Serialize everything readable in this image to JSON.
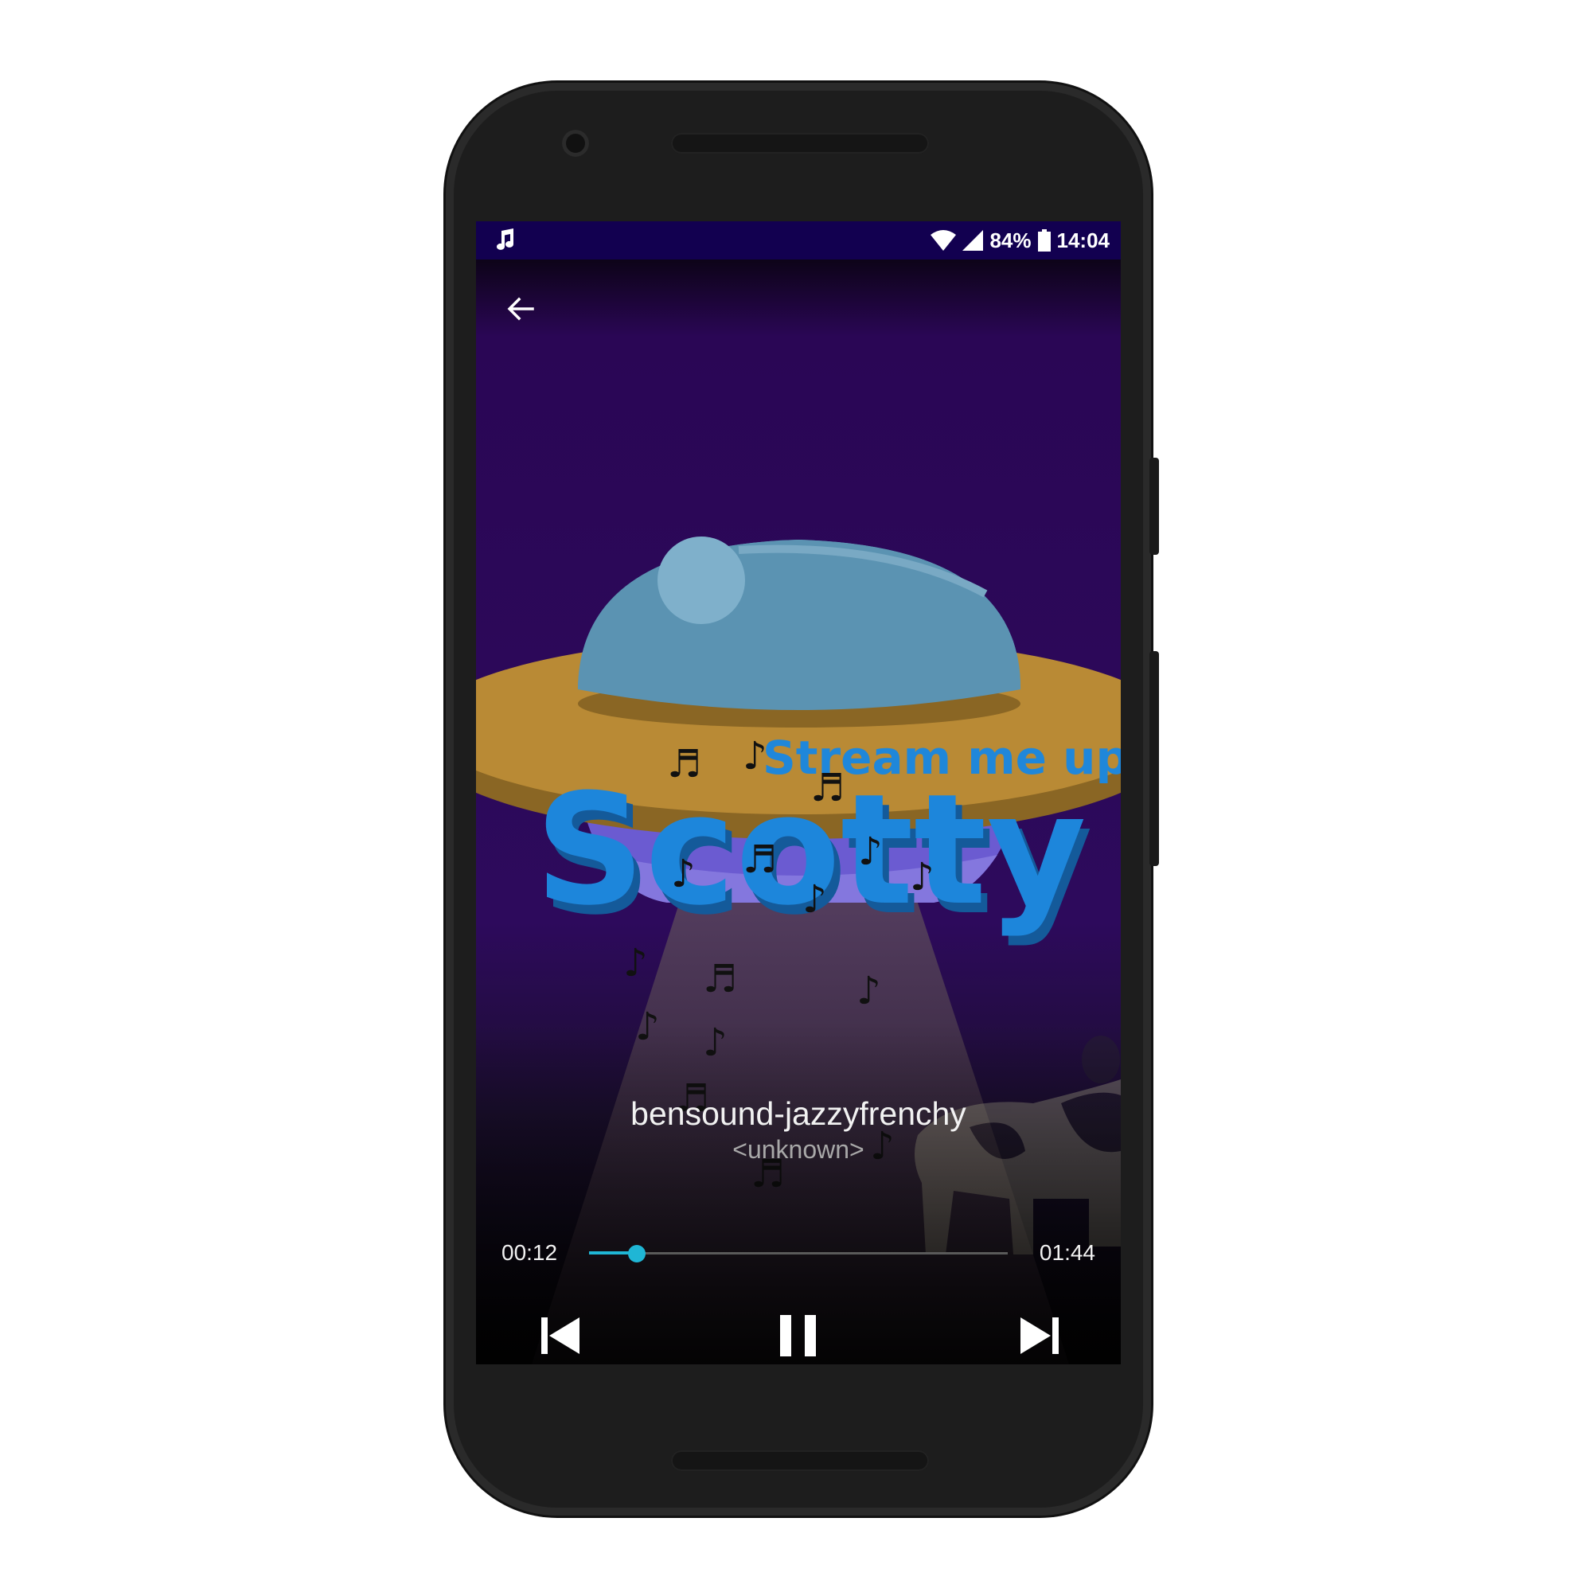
{
  "status_bar": {
    "notification_icon": "music-note-icon",
    "battery_percent": "84%",
    "time": "14:04"
  },
  "artwork": {
    "subtitle_text": "Stream me up",
    "title_text": "Scotty"
  },
  "player": {
    "track_title": "bensound-jazzyfrenchy",
    "artist": "<unknown>",
    "elapsed": "00:12",
    "duration": "01:44",
    "progress_fraction": 0.115,
    "accent_color": "#1fb6d5",
    "controls": {
      "back": "arrow-left-icon",
      "previous": "skip-previous-icon",
      "pause": "pause-icon",
      "next": "skip-next-icon"
    }
  }
}
